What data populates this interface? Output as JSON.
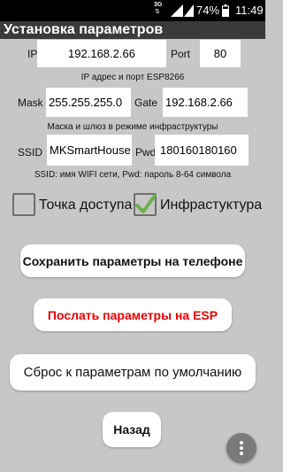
{
  "status_bar": {
    "network_type": "3G",
    "battery_percent": "74%",
    "time": "11:49"
  },
  "app": {
    "title": "Установка параметров"
  },
  "ip_row": {
    "ip_label": "IP",
    "ip_value": "192.168.2.66",
    "port_label": "Port",
    "port_value": "80"
  },
  "ip_hint": "IP адрес и порт ESP8266",
  "mask_row": {
    "mask_label": "Mask",
    "mask_value": "255.255.255.0",
    "gate_label": "Gate",
    "gate_value": "192.168.2.66"
  },
  "mask_hint": "Маска и шлюз в режиме инфраструктуры",
  "wifi_row": {
    "ssid_label": "SSID",
    "ssid_value": "MKSmartHouse",
    "pwd_label": "Pwd",
    "pwd_value": "180160180160"
  },
  "wifi_hint": "SSID: имя WIFI сети, Pwd: пароль 8-64 символа",
  "mode": {
    "access_point_label": "Точка доступа",
    "access_point_checked": false,
    "infrastructure_label": "Инфрастуктура",
    "infrastructure_checked": true
  },
  "buttons": {
    "save_label": "Сохранить параметры на телефоне",
    "send_label": "Послать параметры на ESP",
    "reset_label": "Сброс к параметрам по умолчанию",
    "back_label": "Назад"
  },
  "colors": {
    "background": "#c7c7c7",
    "accent_send": "#e60000",
    "checkmark": "#6ab04c",
    "title_bar": "#3a3a3a"
  },
  "icons": {
    "overflow_menu": "more-vert-icon",
    "checkmark": "check-icon"
  }
}
